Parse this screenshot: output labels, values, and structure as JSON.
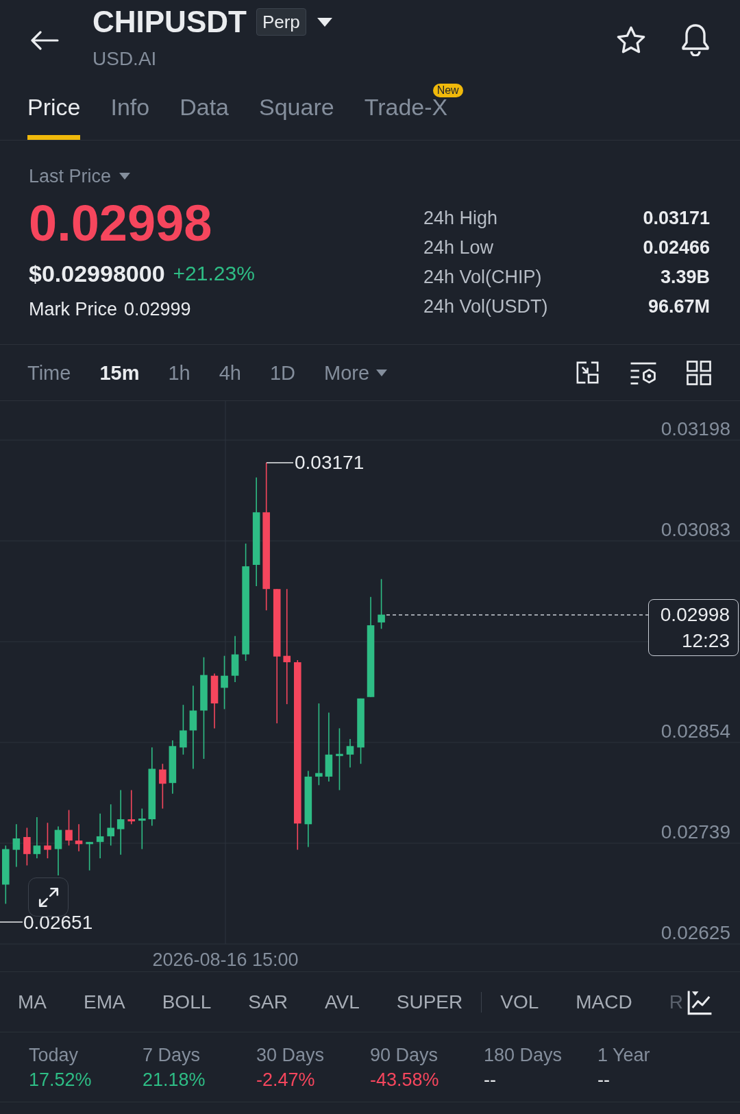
{
  "header": {
    "symbol": "CHIPUSDT",
    "contract_badge": "Perp",
    "subtitle": "USD.AI"
  },
  "tabs": [
    {
      "label": "Price",
      "selected": true
    },
    {
      "label": "Info",
      "selected": false
    },
    {
      "label": "Data",
      "selected": false
    },
    {
      "label": "Square",
      "selected": false
    },
    {
      "label": "Trade-X",
      "selected": false,
      "badge": "New"
    }
  ],
  "price_panel": {
    "label": "Last Price",
    "last_price": {
      "value": "0.02998",
      "rising": false
    },
    "usd_price": "$0.02998000",
    "change": {
      "text": "+21.23%",
      "rising": true
    },
    "mark_price_label": "Mark Price",
    "mark_price": "0.02999"
  },
  "stats": [
    {
      "label": "24h High",
      "value": "0.03171"
    },
    {
      "label": "24h Low",
      "value": "0.02466"
    },
    {
      "label": "24h Vol(CHIP)",
      "value": "3.39B"
    },
    {
      "label": "24h Vol(USDT)",
      "value": "96.67M"
    }
  ],
  "timeframes": [
    {
      "label": "Time",
      "selected": false
    },
    {
      "label": "15m",
      "selected": true
    },
    {
      "label": "1h",
      "selected": false
    },
    {
      "label": "4h",
      "selected": false
    },
    {
      "label": "1D",
      "selected": false
    }
  ],
  "more_button": "More",
  "chart": {
    "price_scale": [
      "0.03198",
      "0.03083",
      "0.02854",
      "0.02739",
      "0.02625"
    ],
    "high_marker": "0.03171",
    "low_marker": "0.02651",
    "last_price_tag": {
      "price": "0.02998",
      "countdown": "12:23"
    },
    "time_label": "2026-08-16 15:00"
  },
  "indicators": {
    "main": [
      "MA",
      "EMA",
      "BOLL",
      "SAR",
      "AVL",
      "SUPER"
    ],
    "sub": [
      "VOL",
      "MACD",
      "R"
    ]
  },
  "performance": [
    {
      "period": "Today",
      "value": "17.52%",
      "color": "#2ebd85"
    },
    {
      "period": "7 Days",
      "value": "21.18%",
      "color": "#2ebd85"
    },
    {
      "period": "30 Days",
      "value": "-2.47%",
      "color": "#f6465d"
    },
    {
      "period": "90 Days",
      "value": "-43.58%",
      "color": "#f6465d"
    },
    {
      "period": "180 Days",
      "value": "--",
      "color": "#eaecef"
    },
    {
      "period": "1 Year",
      "value": "--",
      "color": "#eaecef"
    }
  ]
}
